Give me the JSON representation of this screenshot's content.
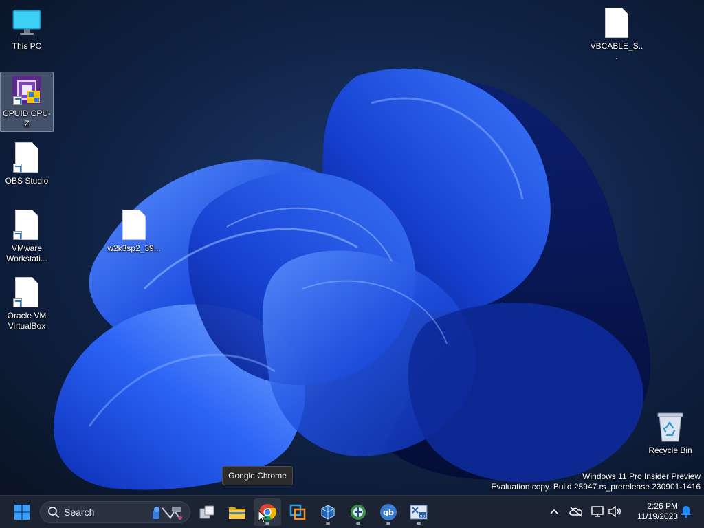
{
  "desktop": {
    "icons": [
      {
        "label": "This PC",
        "icon": "monitor-icon"
      },
      {
        "label": "CPUID CPU-Z",
        "icon": "cpu-z-icon"
      },
      {
        "label": "OBS Studio",
        "icon": "file-icon"
      },
      {
        "label": "VMware Workstati...",
        "icon": "file-icon"
      },
      {
        "label": "Oracle VM VirtualBox",
        "icon": "file-icon"
      },
      {
        "label": "w2k3sp2_39...",
        "icon": "file-icon"
      },
      {
        "label": "VBCABLE_S...",
        "icon": "file-icon"
      },
      {
        "label": "Recycle Bin",
        "icon": "recycle-bin-icon"
      }
    ]
  },
  "tooltip": {
    "text": "Google Chrome"
  },
  "watermark": {
    "line1": "Windows 11 Pro Insider Preview",
    "line2": "Evaluation copy. Build 25947.rs_prerelease.230901-1416"
  },
  "taskbar": {
    "search_label": "Search",
    "apps": [
      "start-icon",
      "task-view-icon",
      "file-explorer-icon",
      "chrome-icon",
      "vmware-icon",
      "virtualbox-icon",
      "app-icon",
      "qbittorrent-icon",
      "windows-xp-icon"
    ],
    "tray": {
      "time": "2:26 PM",
      "date": "11/19/2023"
    }
  },
  "colors": {
    "wallpaper_bg": "#0c1a30",
    "bloom_blue": "#1f4fe0",
    "taskbar_bg": "#1c2433",
    "accent": "#1a8cff"
  }
}
